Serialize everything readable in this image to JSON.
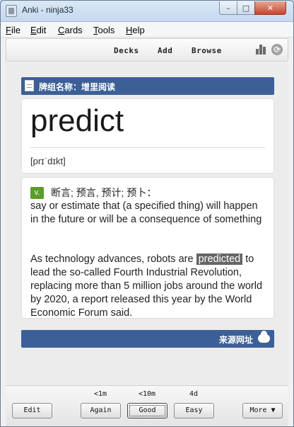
{
  "window": {
    "title": "Anki - ninja33",
    "minimize": "–",
    "maximize": "□",
    "close": "✕"
  },
  "menu": [
    {
      "first": "F",
      "rest": "ile"
    },
    {
      "first": "E",
      "rest": "dit"
    },
    {
      "first": "C",
      "rest": "ards"
    },
    {
      "first": "T",
      "rest": "ools"
    },
    {
      "first": "H",
      "rest": "elp"
    }
  ],
  "toolbar": {
    "decks": "Decks",
    "add": "Add",
    "browse": "Browse",
    "stats_icon": "bar-chart-icon",
    "sync_icon": "sync-icon",
    "sync_glyph": "⟳"
  },
  "card": {
    "deck_label": "牌组名称：增里阅读",
    "word": "predict",
    "phonetic": "[prɪˈdɪkt]",
    "pos": "v.",
    "cn_definition": "断言; 预言, 预计; 预卜：",
    "en_definition": "say or estimate that (a specified thing) will happen in the future or will be a consequence of something",
    "example_before": "As technology advances, robots are ",
    "example_highlight": "predicted",
    "example_after": " to lead the so-called Fourth Industrial Revolution, replacing more than 5 million jobs around the world by 2020, a report released this year by the World Economic Forum said.",
    "source_label": "来源网址",
    "colors": {
      "bar": "#3c5f98",
      "pos_badge": "#5a9d2c",
      "highlight": "#666666"
    }
  },
  "review": {
    "edit": "Edit",
    "again": {
      "interval": "<1m",
      "label": "Again"
    },
    "good": {
      "interval": "<10m",
      "label": "Good"
    },
    "easy": {
      "interval": "4d",
      "label": "Easy"
    },
    "more": "More ▼"
  }
}
